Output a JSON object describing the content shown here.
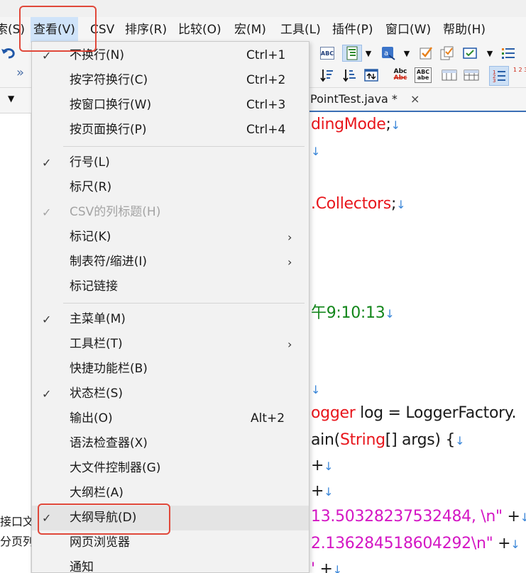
{
  "menubar": {
    "items": [
      {
        "label": "索(S)"
      },
      {
        "label": "查看(V)"
      },
      {
        "label": "CSV"
      },
      {
        "label": "排序(R)"
      },
      {
        "label": "比较(O)"
      },
      {
        "label": "宏(M)"
      },
      {
        "label": "工具(L)"
      },
      {
        "label": "插件(P)"
      },
      {
        "label": "窗口(W)"
      },
      {
        "label": "帮助(H)"
      }
    ],
    "active_index": 1
  },
  "toolbar": {
    "overflow_glyph": "»",
    "icons": [
      "undo-icon",
      "spell-check-icon",
      "outline-icon",
      "font-icon",
      "validate-icon",
      "copy-icon",
      "check-icon",
      "list-icon",
      "sort-desc-icon",
      "sort-desc-2-icon",
      "export-icon",
      "compare-abc-icon",
      "word-wrap-abc-icon",
      "column-icon",
      "grid-icon",
      "line-numbers-icon",
      "ruler-icon"
    ],
    "text_icons": {
      "abc": "ABC",
      "abc2": "Abc",
      "abe": "abe",
      "ruler": "1 2 3"
    }
  },
  "left_panel": {
    "line1": "接口文",
    "line2": "分页列"
  },
  "tab": {
    "title": "PointTest.java *",
    "close": "×"
  },
  "code_lines": [
    [
      {
        "text": "dingMode",
        "c": "red"
      },
      {
        "text": ";",
        "c": "black"
      },
      {
        "text": "↓",
        "c": "nl"
      }
    ],
    [
      {
        "text": "↓",
        "c": "nl"
      }
    ],
    [],
    [
      {
        "text": ".Collectors",
        "c": "red"
      },
      {
        "text": ";",
        "c": "black"
      },
      {
        "text": "↓",
        "c": "nl"
      }
    ],
    [],
    [],
    [],
    [
      {
        "text": "午9:10:13",
        "c": "green"
      },
      {
        "text": "↓",
        "c": "nl"
      }
    ],
    [],
    [],
    [
      {
        "text": "↓",
        "c": "nl"
      }
    ],
    [
      {
        "text": "ogger",
        "c": "red"
      },
      {
        "text": " log = LoggerFactory.",
        "c": "black"
      }
    ],
    [
      {
        "text": "ain",
        "c": "black"
      },
      {
        "text": "(",
        "c": "black"
      },
      {
        "text": "String",
        "c": "red"
      },
      {
        "text": "[] args) {",
        "c": "black"
      },
      {
        "text": "↓",
        "c": "nl"
      }
    ],
    [
      {
        "text": "+",
        "c": "black"
      },
      {
        "text": "↓",
        "c": "nl"
      }
    ],
    [
      {
        "text": "+",
        "c": "black"
      },
      {
        "text": "↓",
        "c": "nl"
      }
    ],
    [
      {
        "text": "13.50328237532484, \\n\"",
        "c": "magenta"
      },
      {
        "text": " +",
        "c": "black"
      },
      {
        "text": "↓",
        "c": "nl"
      }
    ],
    [
      {
        "text": "2.136284518604292\\n\"",
        "c": "magenta"
      },
      {
        "text": " +",
        "c": "black"
      },
      {
        "text": "↓",
        "c": "nl"
      }
    ],
    [
      {
        "text": "'",
        "c": "magenta"
      },
      {
        "text": " +",
        "c": "black"
      },
      {
        "text": "↓",
        "c": "nl"
      }
    ]
  ],
  "view_menu": {
    "groups": [
      [
        {
          "label": "不换行(N)",
          "shortcut": "Ctrl+1",
          "checked": true
        },
        {
          "label": "按字符换行(C)",
          "shortcut": "Ctrl+2"
        },
        {
          "label": "按窗口换行(W)",
          "shortcut": "Ctrl+3"
        },
        {
          "label": "按页面换行(P)",
          "shortcut": "Ctrl+4"
        }
      ],
      [
        {
          "label": "行号(L)",
          "checked": true
        },
        {
          "label": "标尺(R)"
        },
        {
          "label": "CSV的列标题(H)",
          "checked": true,
          "disabled": true
        },
        {
          "label": "标记(K)",
          "submenu": true
        },
        {
          "label": "制表符/缩进(I)",
          "submenu": true
        },
        {
          "label": "标记链接"
        }
      ],
      [
        {
          "label": "主菜单(M)",
          "checked": true
        },
        {
          "label": "工具栏(T)",
          "submenu": true
        },
        {
          "label": "快捷功能栏(B)"
        },
        {
          "label": "状态栏(S)",
          "checked": true
        },
        {
          "label": "输出(O)",
          "shortcut": "Alt+2"
        },
        {
          "label": "语法检查器(X)"
        },
        {
          "label": "大文件控制器(G)"
        },
        {
          "label": "大纲栏(A)"
        },
        {
          "label": "大纲导航(D)",
          "checked": true,
          "highlighted": true
        },
        {
          "label": "网页浏览器"
        },
        {
          "label": "通知"
        }
      ]
    ],
    "check_glyph": "✓",
    "submenu_glyph": "›"
  },
  "annotation_color": "#e0483a"
}
